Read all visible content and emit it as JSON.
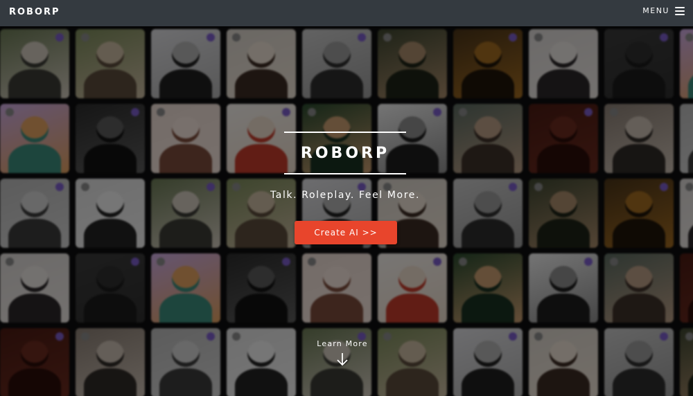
{
  "navbar": {
    "brand": "ROBORP",
    "menu_label": "MENU",
    "menu_icon": "hamburger-icon"
  },
  "hero": {
    "title": "ROBORP",
    "tagline": "Talk. Roleplay. Feel More.",
    "cta_label": "Create AI >>",
    "learn_more_label": "Learn More",
    "learn_more_icon": "arrow-down-icon"
  },
  "colors": {
    "navbar_bg": "#343a40",
    "cta_bg": "#e8452c",
    "text": "#ffffff",
    "badge": "#7a5cc8"
  }
}
